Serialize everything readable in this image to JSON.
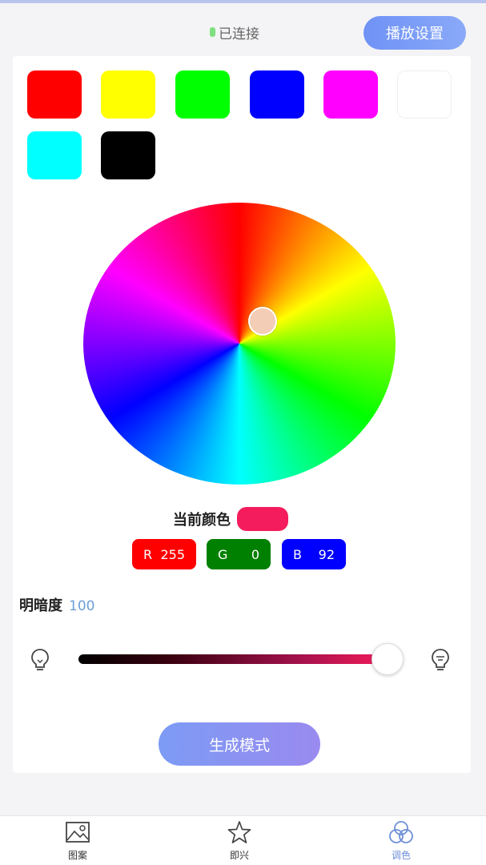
{
  "header": {
    "status_text": "已连接",
    "play_button": "播放设置"
  },
  "swatches": [
    {
      "name": "red",
      "color": "#ff0000"
    },
    {
      "name": "yellow",
      "color": "#ffff00"
    },
    {
      "name": "green",
      "color": "#00ff00"
    },
    {
      "name": "blue",
      "color": "#0000ff"
    },
    {
      "name": "magenta",
      "color": "#ff00ff"
    },
    {
      "name": "white",
      "color": "#ffffff"
    },
    {
      "name": "cyan",
      "color": "#00ffff"
    },
    {
      "name": "black",
      "color": "#000000"
    }
  ],
  "current_color": {
    "label": "当前颜色",
    "color": "#f41c5c"
  },
  "rgb": {
    "r_label": "R",
    "r_value": "255",
    "g_label": "G",
    "g_value": "0",
    "b_label": "B",
    "b_value": "92"
  },
  "brightness": {
    "label": "明暗度",
    "value": "100",
    "level": 1.0
  },
  "generate_button": "生成模式",
  "nav": {
    "items": [
      {
        "label": "图案",
        "icon": "image-icon"
      },
      {
        "label": "即兴",
        "icon": "star-icon"
      },
      {
        "label": "调色",
        "icon": "palette-circles-icon"
      }
    ],
    "active_index": 2
  },
  "colors": {
    "accent": "#6f92f6",
    "r_chip": "#ff0000",
    "g_chip": "#008000",
    "b_chip": "#0000ff"
  }
}
